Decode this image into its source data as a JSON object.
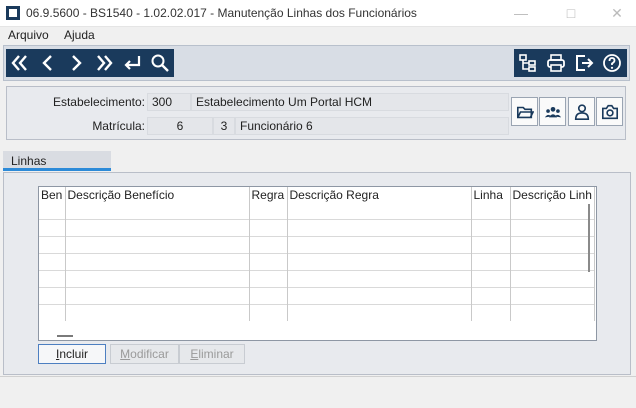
{
  "window": {
    "title": "06.9.5600 - BS1540 - 1.02.02.017 - Manutenção Linhas dos Funcionários"
  },
  "menu": {
    "items": [
      "Arquivo",
      "Ajuda"
    ]
  },
  "toolbar": {
    "nav_icons": [
      "first-icon",
      "previous-icon",
      "next-icon",
      "last-icon",
      "return-icon",
      "search-icon"
    ],
    "right_icons": [
      "structure-icon",
      "print-icon",
      "exit-icon",
      "help-icon"
    ]
  },
  "header": {
    "estabelecimento_label": "Estabelecimento:",
    "estabelecimento_code": "300",
    "estabelecimento_name": "Estabelecimento Um Portal HCM",
    "matricula_label": "Matrícula:",
    "matricula_value": "6",
    "matricula_digit": "3",
    "funcionario_name": "Funcionário 6",
    "side_icons": [
      "folder-icon",
      "group-icon",
      "person-icon",
      "camera-icon"
    ]
  },
  "tabs": [
    "Linhas"
  ],
  "grid": {
    "columns": [
      "Ben",
      "Descrição Benefício",
      "Regra",
      "Descrição Regra",
      "Linha",
      "Descrição Linh"
    ]
  },
  "buttons": {
    "incluir": "ncluir",
    "incluir_accel": "I",
    "modificar": "odificar",
    "modificar_accel": "M",
    "eliminar": "liminar",
    "eliminar_accel": "E"
  }
}
